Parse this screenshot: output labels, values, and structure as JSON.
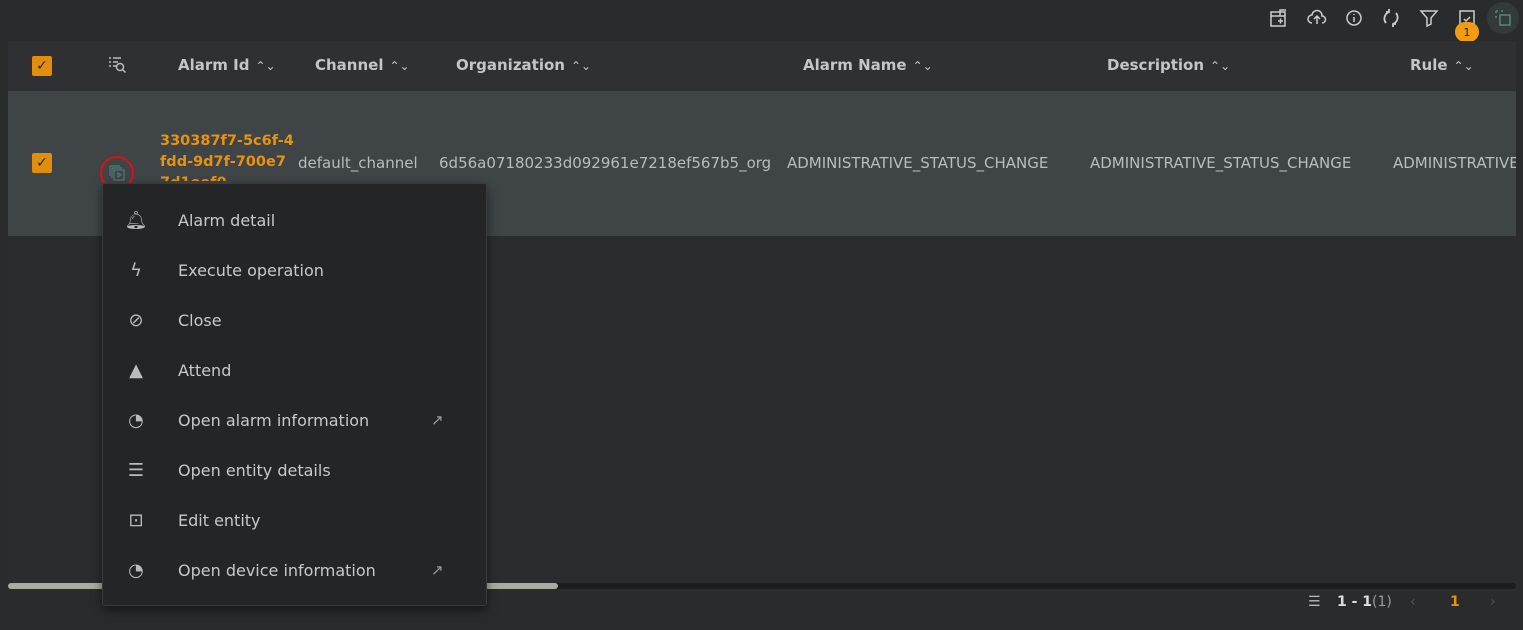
{
  "toolbar": {
    "icons": [
      "export-icon",
      "upload-icon",
      "info-icon",
      "refresh-icon",
      "filter-icon",
      "checklist-icon",
      "multi-select-icon"
    ],
    "badge": "1"
  },
  "table": {
    "columns": [
      "Alarm Id",
      "Channel",
      "Organization",
      "Alarm Name",
      "Description",
      "Rule"
    ],
    "sort_glyph": "⌃⌄",
    "row": {
      "alarm_id": "330387f7-5c6f-4fdd-9d7f-700e77d1eef0",
      "channel": "default_channel",
      "organization": "6d56a07180233d092961e7218ef567b5_org",
      "alarm_name": "ADMINISTRATIVE_STATUS_CHANGE",
      "description": "ADMINISTRATIVE_STATUS_CHANGE",
      "rule": "ADMINISTRATIVE_STATUS_CHANGE"
    }
  },
  "menu": [
    {
      "icon": "bell-icon",
      "glyph": "🔔︎",
      "label": "Alarm detail"
    },
    {
      "icon": "bolt-icon",
      "glyph": "ϟ",
      "label": "Execute operation"
    },
    {
      "icon": "bell-off-icon",
      "glyph": "⊘",
      "label": "Close"
    },
    {
      "icon": "warning-icon",
      "glyph": "▲",
      "label": "Attend"
    },
    {
      "icon": "gauge-icon",
      "glyph": "◔",
      "label": "Open alarm information",
      "external": true
    },
    {
      "icon": "list-icon",
      "glyph": "☰",
      "label": "Open entity details"
    },
    {
      "icon": "edit-entity-icon",
      "glyph": "⊡",
      "label": "Edit entity"
    },
    {
      "icon": "gauge-icon",
      "glyph": "◔",
      "label": "Open device information",
      "external": true
    }
  ],
  "pager": {
    "range": "1 - 1",
    "total": "(1)",
    "page": "1"
  },
  "colors": {
    "accent": "#e8920f",
    "row_bg": "#3f4447",
    "menu_bg": "#242526"
  }
}
